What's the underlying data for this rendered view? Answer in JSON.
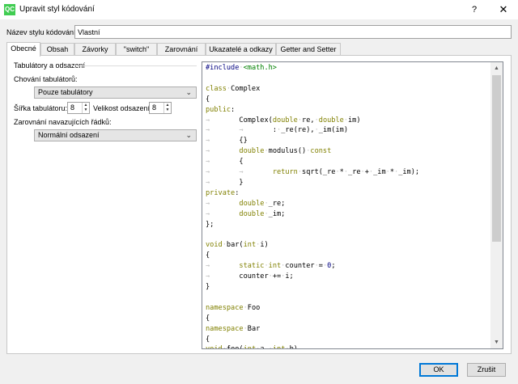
{
  "window": {
    "title": "Upravit styl kódování",
    "help": "?",
    "close": "✕",
    "icon_text": "QC"
  },
  "name_row": {
    "label": "Název stylu kódování:",
    "value": "Vlastní"
  },
  "tabs": [
    {
      "label": "Obecné",
      "active": true
    },
    {
      "label": "Obsah"
    },
    {
      "label": "Závorky"
    },
    {
      "label": "\"switch\""
    },
    {
      "label": "Zarovnání"
    },
    {
      "label": "Ukazatelé a odkazy"
    },
    {
      "label": "Getter and Setter"
    }
  ],
  "left": {
    "group_title": "Tabulátory a odsazení",
    "tab_policy_label": "Chování tabulátorů:",
    "tab_policy_value": "Pouze tabulátory",
    "tab_size_label": "Šířka tabulátoru:",
    "tab_size_value": "8",
    "indent_size_label": "Velikost odsazení:",
    "indent_size_value": "8",
    "continuation_label": "Zarovnání navazujících řádků:",
    "continuation_value": "Normální odsazení"
  },
  "code_lines": [
    "#include <math.h>",
    "",
    "class Complex",
    "{",
    "public:",
    "\tComplex(double re, double im)",
    "\t\t: _re(re), _im(im)",
    "\t{}",
    "\tdouble modulus() const",
    "\t{",
    "\t\treturn sqrt(_re * _re + _im * _im);",
    "\t}",
    "private:",
    "\tdouble _re;",
    "\tdouble _im;",
    "};",
    "",
    "void bar(int i)",
    "{",
    "\tstatic int counter = 0;",
    "\tcounter += i;",
    "}",
    "",
    "namespace Foo",
    "{",
    "namespace Bar",
    "{",
    "void foo(int a, int b)"
  ],
  "buttons": {
    "ok": "OK",
    "cancel": "Zrušit"
  },
  "colors": {
    "keyword": "#808000",
    "preprocessor": "#000080",
    "include": "#008000",
    "whitespace_marker": "#c0c0c0"
  }
}
